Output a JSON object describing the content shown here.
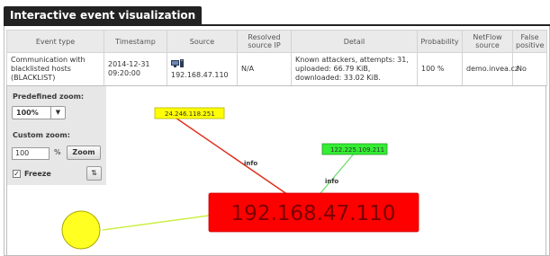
{
  "header": {
    "title": "Interactive event visualization"
  },
  "table": {
    "columns": [
      "Event type",
      "Timestamp",
      "Source",
      "Resolved source IP",
      "Detail",
      "Probability",
      "NetFlow source",
      "False positive"
    ],
    "row": {
      "event_type": "Communication with blacklisted hosts (BLACKLIST)",
      "timestamp": "2014-12-31 09:20:00",
      "source": "192.168.47.110",
      "resolved_ip": "N/A",
      "detail": "Known attackers, attempts: 31, uploaded: 66.79 KiB, downloaded: 33.02 KiB.",
      "probability": "100 %",
      "netflow_source": "demo.invea.cz",
      "false_positive": "No"
    }
  },
  "controls": {
    "predefined_zoom_label": "Predefined zoom:",
    "predefined_zoom_value": "100%",
    "custom_zoom_label": "Custom zoom:",
    "custom_zoom_value": "100",
    "percent_sign": "%",
    "zoom_button": "Zoom",
    "freeze_label": "Freeze",
    "freeze_checked": true
  },
  "graph": {
    "main_node": {
      "label": "192.168.47.110",
      "color": "#ff0000"
    },
    "node_a": {
      "label": "24.246.118.251",
      "color": "#ffff00"
    },
    "node_b": {
      "label": "122.225.109.211",
      "color": "#33ee33"
    },
    "edge_label_a": "info",
    "edge_label_b": "info",
    "edge_color_a": "#e0301e",
    "edge_color_b": "#66dd66",
    "edge_color_circle": "#ccee44",
    "circle_color": "#ffff22"
  }
}
